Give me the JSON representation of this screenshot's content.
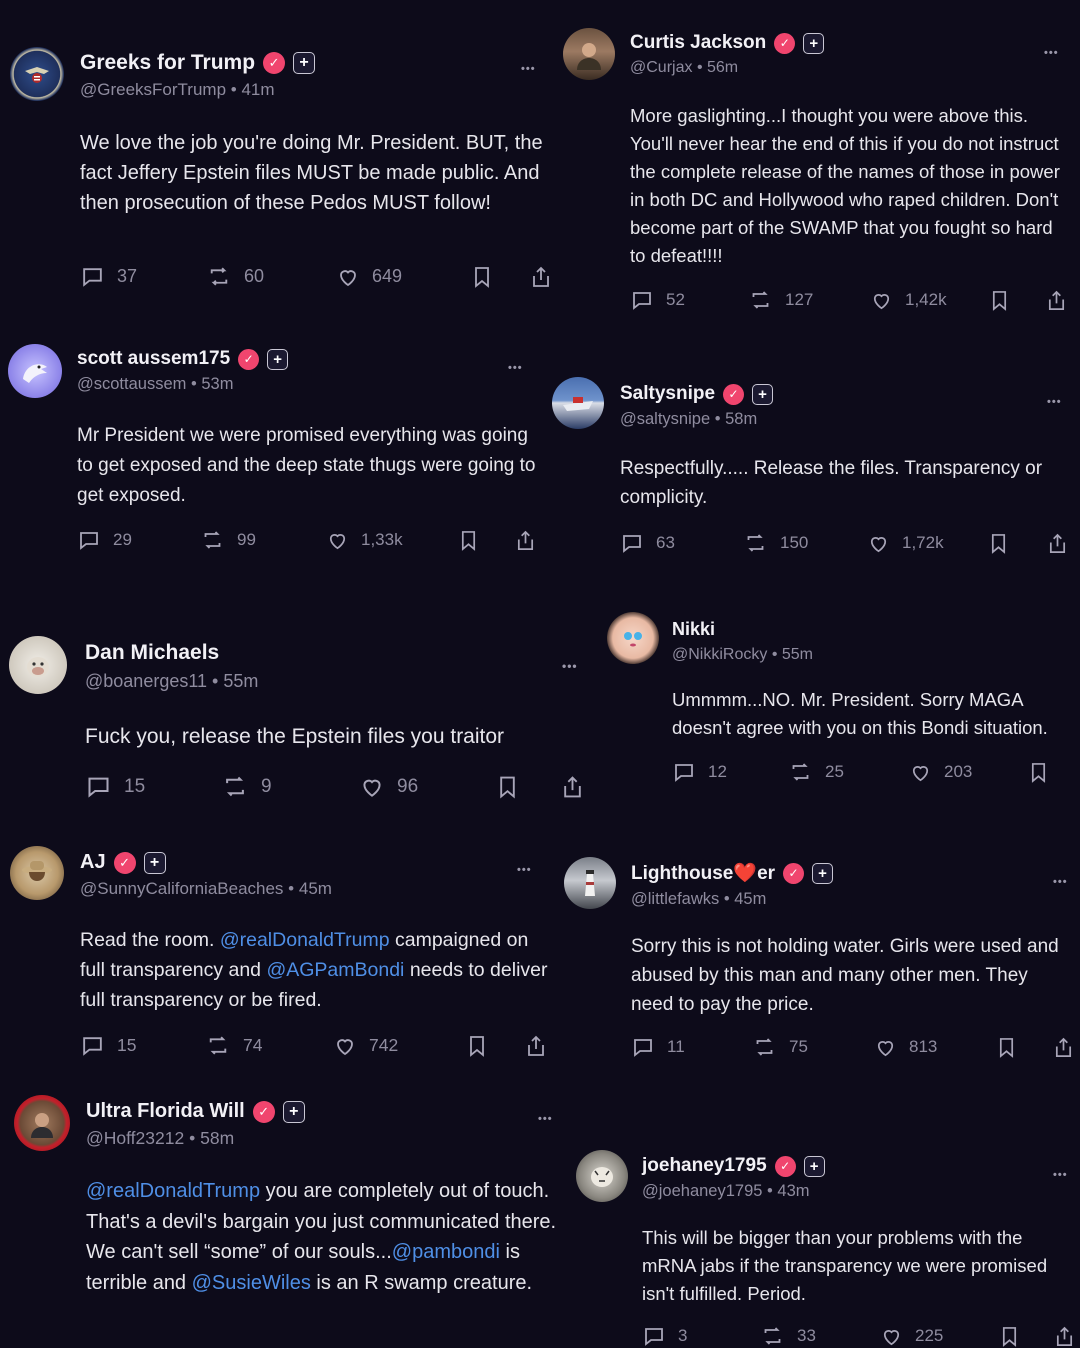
{
  "posts": [
    {
      "id": "greeks",
      "avatar_icon": "eagle-seal-icon",
      "name": "Greeks for Trump",
      "handle": "@GreeksForTrump",
      "time": "41m",
      "verified": true,
      "text": "We love the job you're doing Mr. President. BUT, the fact Jeffery Epstein files MUST be made public. And then prosecution of these Pedos MUST follow!",
      "replies": "37",
      "reposts": "60",
      "likes": "649"
    },
    {
      "id": "curtis",
      "avatar_icon": "man-portrait-icon",
      "name": "Curtis Jackson",
      "handle": "@Curjax",
      "time": "56m",
      "verified": true,
      "text": "More gaslighting...I thought you were above this. You'll never hear the end of this if you do not instruct the complete release of the names of those in power in both DC and Hollywood who raped children. Don't become part of the SWAMP that you fought so hard to defeat!!!!",
      "replies": "52",
      "reposts": "127",
      "likes": "1,42k"
    },
    {
      "id": "scott",
      "avatar_icon": "eagle-head-icon",
      "name": "scott aussem175",
      "handle": "@scottaussem",
      "time": "53m",
      "verified": true,
      "text": "Mr President we were promised everything was going to get exposed and the deep state thugs were going to get exposed.",
      "replies": "29",
      "reposts": "99",
      "likes": "1,33k"
    },
    {
      "id": "saltysnipe",
      "avatar_icon": "ship-icon",
      "name": "Saltysnipe",
      "handle": "@saltysnipe",
      "time": "58m",
      "verified": true,
      "text": "Respectfully..... Release the files. Transparency or complicity.",
      "replies": "63",
      "reposts": "150",
      "likes": "1,72k"
    },
    {
      "id": "dan",
      "avatar_icon": "gorilla-icon",
      "name": "Dan Michaels",
      "handle": "@boanerges11",
      "time": "55m",
      "verified": false,
      "text": "Fuck you, release the Epstein files you traitor",
      "replies": "15",
      "reposts": "9",
      "likes": "96"
    },
    {
      "id": "nikki",
      "avatar_icon": "woman-cartoon-icon",
      "name": "Nikki",
      "handle": "@NikkiRocky",
      "time": "55m",
      "verified": false,
      "text": "Ummmm...NO. Mr. President. Sorry MAGA doesn't agree with you on this Bondi situation.",
      "replies": "12",
      "reposts": "25",
      "likes": "203"
    },
    {
      "id": "aj",
      "avatar_icon": "hat-woman-icon",
      "name": "AJ",
      "handle": "@SunnyCaliforniaBeaches",
      "time": "45m",
      "verified": true,
      "text_parts": [
        "Read the room. ",
        "@realDonaldTrump",
        " campaigned on full transparency and ",
        "@AGPamBondi",
        " needs to deliver full transparency or be fired."
      ],
      "replies": "15",
      "reposts": "74",
      "likes": "742"
    },
    {
      "id": "lighthouse",
      "avatar_icon": "lighthouse-icon",
      "name_a": "Lighthouse",
      "name_heart": "❤️",
      "name_b": "er",
      "handle": "@littlefawks",
      "time": "45m",
      "verified": true,
      "text": "Sorry this is not holding water. Girls were used and abused by this man and many other men. They need to pay the price.",
      "replies": "11",
      "reposts": "75",
      "likes": "813"
    },
    {
      "id": "ultra",
      "avatar_icon": "man-red-ring-icon",
      "name": "Ultra Florida Will",
      "handle": "@Hoff23212",
      "time": "58m",
      "verified": true,
      "text_parts": [
        "@realDonaldTrump",
        " you are completely out of touch. That's a devil's bargain you just communicated there. We can't sell “some” of our souls...",
        "@pambondi",
        " is terrible and ",
        "@SusieWiles",
        " is an R swamp creature."
      ]
    },
    {
      "id": "joehaney",
      "avatar_icon": "tiger-icon",
      "name": "joehaney1795",
      "handle": "@joehaney1795",
      "time": "43m",
      "verified": true,
      "text": "This will be bigger than your problems with the mRNA jabs if the transparency we were promised isn't fulfilled. Period.",
      "replies": "3",
      "reposts": "33",
      "likes": "225"
    }
  ],
  "ui": {
    "separator": "•",
    "more": "•••",
    "verified_mark": "✓",
    "plus_mark": "+"
  }
}
